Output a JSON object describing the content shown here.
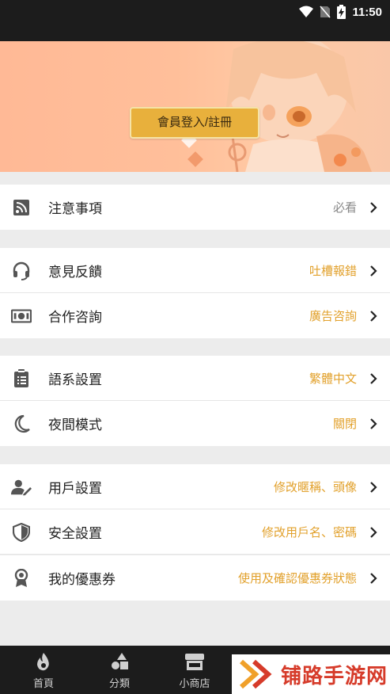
{
  "status": {
    "time": "11:50"
  },
  "banner": {
    "login_label": "會員登入/註冊"
  },
  "menu": {
    "notice": {
      "label": "注意事項",
      "value": "必看"
    },
    "feedback": {
      "label": "意見反饋",
      "value": "吐槽報錯"
    },
    "cooperation": {
      "label": "合作咨詢",
      "value": "廣告咨詢"
    },
    "language": {
      "label": "語系設置",
      "value": "繁體中文"
    },
    "night_mode": {
      "label": "夜間模式",
      "value": "關閉"
    },
    "user_settings": {
      "label": "用戶設置",
      "value": "修改暱稱、頭像"
    },
    "security": {
      "label": "安全設置",
      "value": "修改用戶名、密碼"
    },
    "coupons": {
      "label": "我的優惠券",
      "value": "使用及確認優惠券狀態"
    }
  },
  "tabs": {
    "home": "首頁",
    "category": "分類",
    "shop": "小商店"
  },
  "watermark": {
    "text": "铺路手游网"
  },
  "colors": {
    "accent": "#e2a12c",
    "login_button": "#e8b03c",
    "banner": "#ffb996",
    "tabbar": "#1c1c1c"
  }
}
